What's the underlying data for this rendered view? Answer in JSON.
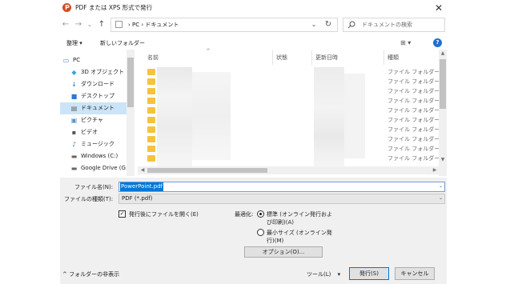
{
  "window": {
    "title": "PDF または XPS 形式で発行",
    "close_label": "✕"
  },
  "address": {
    "back": "←",
    "forward": "→",
    "recent": "⌄",
    "up": "↑",
    "path": "› PC › ドキュメント",
    "dropdown": "⌄",
    "refresh": "↻"
  },
  "search": {
    "placeholder": "ドキュメントの検索"
  },
  "toolbar": {
    "organize": "整理 ▾",
    "new_folder": "新しいフォルダー",
    "view": "⊞ ▾",
    "help": "?"
  },
  "nav": {
    "items": [
      {
        "label": "PC",
        "icon": "▭"
      },
      {
        "label": "3D オブジェクト",
        "icon": "◆"
      },
      {
        "label": "ダウンロード",
        "icon": "↓"
      },
      {
        "label": "デスクトップ",
        "icon": "■"
      },
      {
        "label": "ドキュメント",
        "icon": "▤"
      },
      {
        "label": "ピクチャ",
        "icon": "▣"
      },
      {
        "label": "ビデオ",
        "icon": "▪"
      },
      {
        "label": "ミュージック",
        "icon": "♪"
      },
      {
        "label": "Windows (C:)",
        "icon": "▬"
      },
      {
        "label": "Google Drive (G:",
        "icon": "▬"
      }
    ]
  },
  "columns": {
    "name": "名前",
    "status": "状態",
    "modified": "更新日時",
    "type": "種類"
  },
  "files": {
    "rows": [
      {
        "type": "ファイル フォルダー"
      },
      {
        "type": "ファイル フォルダー"
      },
      {
        "type": "ファイル フォルダー"
      },
      {
        "type": "ファイル フォルダー"
      },
      {
        "type": "ファイル フォルダー"
      },
      {
        "type": "ファイル フォルダー"
      },
      {
        "type": "ファイル フォルダー"
      },
      {
        "type": "ファイル フォルダー"
      },
      {
        "type": "ファイル フォルダー"
      },
      {
        "type": "ファイル フォルダー"
      }
    ]
  },
  "form": {
    "filename_label": "ファイル名(N):",
    "filename_value": "PowerPoint.pdf",
    "filetype_label": "ファイルの種類(T):",
    "filetype_value": "PDF (*.pdf)",
    "open_after_label": "発行後にファイルを開く(E)",
    "open_after_checked": "✓",
    "optimize_label": "最適化:",
    "optimize_standard_line1": "標準 (オンライン発行およ",
    "optimize_standard_line2": "び印刷)(A)",
    "optimize_min_line1": "最小サイズ (オンライン発",
    "optimize_min_line2": "行)(M)",
    "options_button": "オプション(O)..."
  },
  "footer": {
    "hide_folders": "フォルダーの非表示",
    "hide_caret": "^",
    "tools": "ツール(L)",
    "tools_caret": "▾",
    "publish": "発行(S)",
    "cancel": "キャンセル"
  }
}
